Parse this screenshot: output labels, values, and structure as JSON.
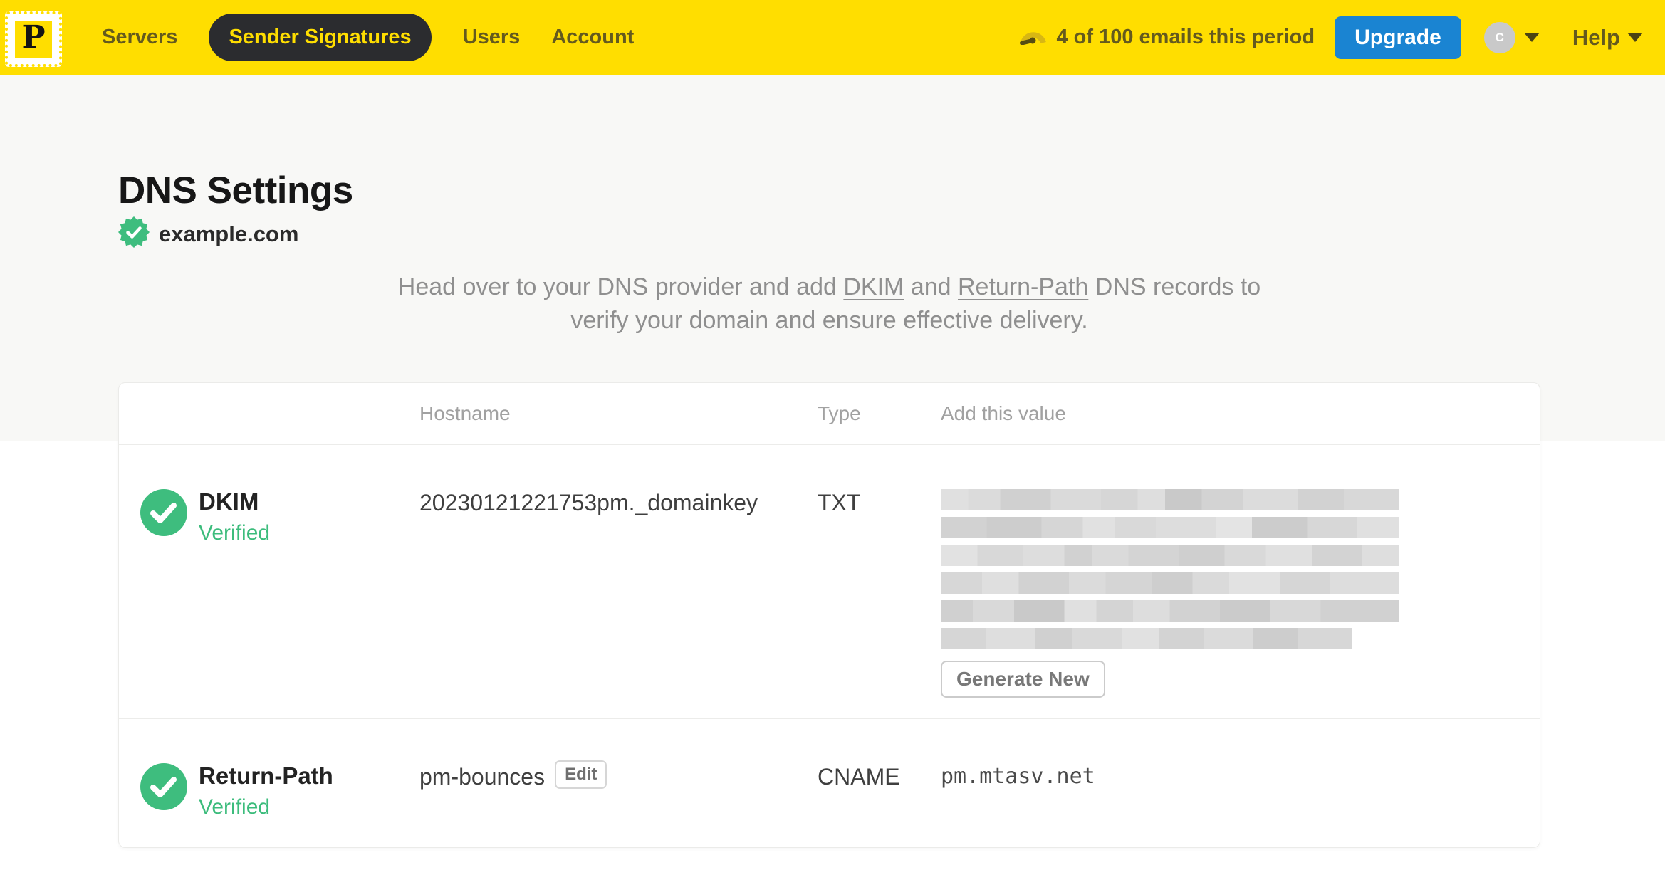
{
  "header": {
    "logo_letter": "P",
    "nav": [
      {
        "label": "Servers",
        "active": false
      },
      {
        "label": "Sender Signatures",
        "active": true
      },
      {
        "label": "Users",
        "active": false
      },
      {
        "label": "Account",
        "active": false
      }
    ],
    "usage_text": "4 of 100 emails this period",
    "upgrade_label": "Upgrade",
    "avatar_initial": "C",
    "help_label": "Help"
  },
  "page": {
    "title": "DNS Settings",
    "domain": "example.com",
    "description": {
      "line1_before": "Head over to your DNS provider and add ",
      "dkim_link": "DKIM",
      "line1_mid": " and ",
      "return_path_link": "Return-Path",
      "line1_after": " DNS records to",
      "line2": "verify your domain and ensure effective delivery."
    }
  },
  "table": {
    "columns": [
      "Hostname",
      "Type",
      "Add this value"
    ],
    "rows": [
      {
        "name": "DKIM",
        "status": "Verified",
        "hostname": "20230121221753pm._domainkey",
        "type": "TXT",
        "value_redacted": true,
        "action": "Generate New"
      },
      {
        "name": "Return-Path",
        "status": "Verified",
        "hostname": "pm-bounces",
        "hostname_action": "Edit",
        "type": "CNAME",
        "value": "pm.mtasv.net"
      }
    ]
  },
  "icons": {
    "logo": "postmark-stamp-icon",
    "usage": "gauge-icon",
    "domain_status": "verified-seal-icon",
    "row_status": "check-circle-icon",
    "dropdown": "caret-down-icon"
  },
  "colors": {
    "brand_yellow": "#FFDE00",
    "nav_active_bg": "#2B2C2F",
    "upgrade_blue": "#1A84D2",
    "success_green": "#3EBD7E",
    "header_text": "#645A1E"
  }
}
